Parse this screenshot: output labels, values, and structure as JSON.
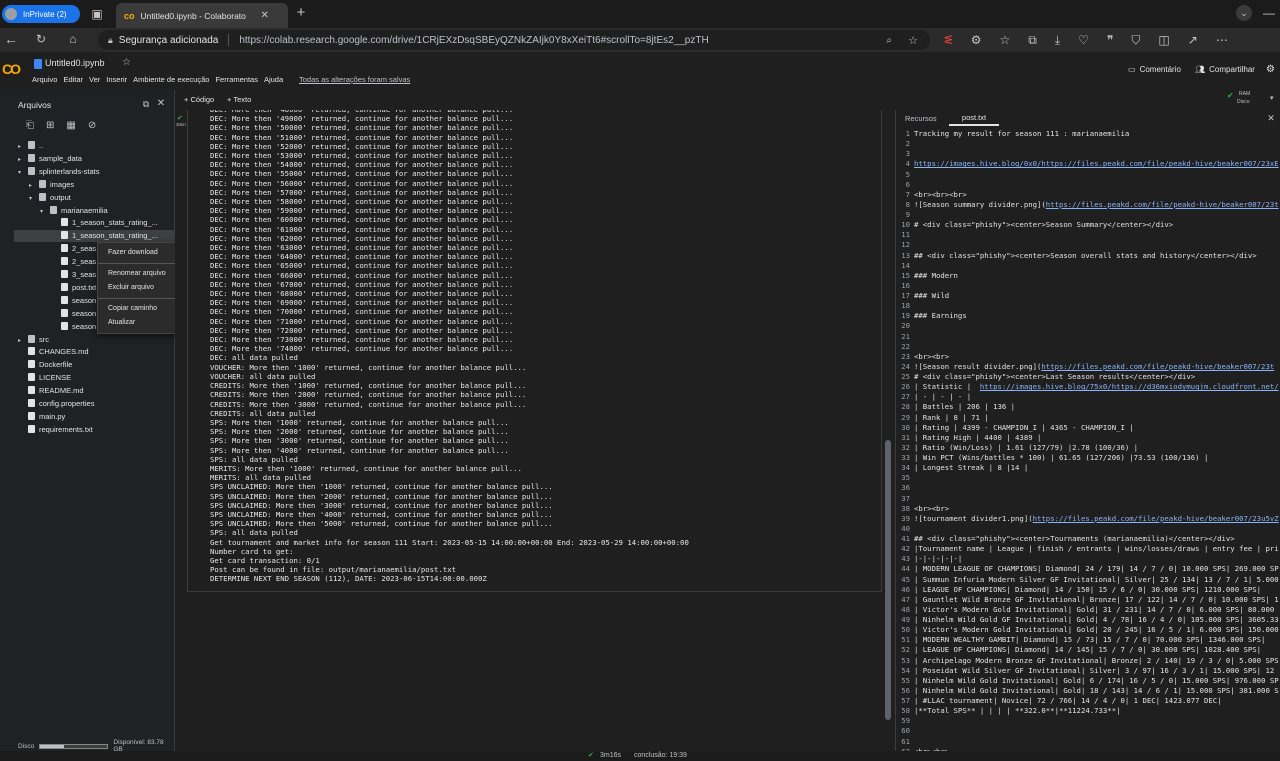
{
  "browser": {
    "profile": "InPrivate (2)",
    "tab_title": "Untitled0.ipynb - Colaborato",
    "security": "Segurança adicionada",
    "url": "https://colab.research.google.com/drive/1CRjEXzDsqSBEyQZNkZAIjk0Y8xXeiTt6#scrollTo=8jtEs2__pzTH"
  },
  "colab": {
    "notebook_name": "Untitled0.ipynb",
    "menu": [
      "Arquivo",
      "Editar",
      "Ver",
      "Inserir",
      "Ambiente de execução",
      "Ferramentas",
      "Ajuda"
    ],
    "saved_status": "Todas as alterações foram salvas",
    "comment": "Comentário",
    "share": "Compartilhar",
    "ram_label": "RAM",
    "disk_label": "Disco",
    "add_code": "+ Código",
    "add_text": "+ Texto"
  },
  "sidebar": {
    "title": "Arquivos",
    "disk_label": "Disco",
    "disk_available": "Disponível: 83.78 GB",
    "tree": [
      {
        "label": "..",
        "indent": 0,
        "kind": "folder"
      },
      {
        "label": "sample_data",
        "indent": 0,
        "kind": "folder"
      },
      {
        "label": "splinterlands-stats",
        "indent": 0,
        "kind": "folder-open"
      },
      {
        "label": "images",
        "indent": 1,
        "kind": "folder"
      },
      {
        "label": "output",
        "indent": 1,
        "kind": "folder-open"
      },
      {
        "label": "marianaemilia",
        "indent": 2,
        "kind": "folder-open"
      },
      {
        "label": "1_season_stats_rating_...",
        "indent": 3,
        "kind": "file"
      },
      {
        "label": "1_season_stats_rating_...",
        "indent": 3,
        "kind": "file"
      },
      {
        "label": "2_seas",
        "indent": 3,
        "kind": "file"
      },
      {
        "label": "2_seas",
        "indent": 3,
        "kind": "file"
      },
      {
        "label": "3_seas",
        "indent": 3,
        "kind": "file"
      },
      {
        "label": "post.txt",
        "indent": 3,
        "kind": "file"
      },
      {
        "label": "season",
        "indent": 3,
        "kind": "file"
      },
      {
        "label": "season",
        "indent": 3,
        "kind": "file"
      },
      {
        "label": "season",
        "indent": 3,
        "kind": "file"
      },
      {
        "label": "src",
        "indent": 0,
        "kind": "folder"
      },
      {
        "label": "CHANGES.md",
        "indent": 0,
        "kind": "file"
      },
      {
        "label": "Dockerfile",
        "indent": 0,
        "kind": "file"
      },
      {
        "label": "LICENSE",
        "indent": 0,
        "kind": "file"
      },
      {
        "label": "README.md",
        "indent": 0,
        "kind": "file"
      },
      {
        "label": "config.properties",
        "indent": 0,
        "kind": "file"
      },
      {
        "label": "main.py",
        "indent": 0,
        "kind": "file"
      },
      {
        "label": "requirements.txt",
        "indent": 0,
        "kind": "file"
      }
    ]
  },
  "context_menu": [
    "Fazer download",
    "Renomear arquivo",
    "Excluir arquivo",
    "Copiar caminho",
    "Atualizar"
  ],
  "cell": {
    "exec_time": "3min",
    "output": [
      "DEC: More then '48000' returned, continue for another balance pull...",
      "DEC: More then '49000' returned, continue for another balance pull...",
      "DEC: More then '50000' returned, continue for another balance pull...",
      "DEC: More then '51000' returned, continue for another balance pull...",
      "DEC: More then '52000' returned, continue for another balance pull...",
      "DEC: More then '53000' returned, continue for another balance pull...",
      "DEC: More then '54000' returned, continue for another balance pull...",
      "DEC: More then '55000' returned, continue for another balance pull...",
      "DEC: More then '56000' returned, continue for another balance pull...",
      "DEC: More then '57000' returned, continue for another balance pull...",
      "DEC: More then '58000' returned, continue for another balance pull...",
      "DEC: More then '59000' returned, continue for another balance pull...",
      "DEC: More then '60000' returned, continue for another balance pull...",
      "DEC: More then '61000' returned, continue for another balance pull...",
      "DEC: More then '62000' returned, continue for another balance pull...",
      "DEC: More then '63000' returned, continue for another balance pull...",
      "DEC: More then '64000' returned, continue for another balance pull...",
      "DEC: More then '65000' returned, continue for another balance pull...",
      "DEC: More then '66000' returned, continue for another balance pull...",
      "DEC: More then '67000' returned, continue for another balance pull...",
      "DEC: More then '68000' returned, continue for another balance pull...",
      "DEC: More then '69000' returned, continue for another balance pull...",
      "DEC: More then '70000' returned, continue for another balance pull...",
      "DEC: More then '71000' returned, continue for another balance pull...",
      "DEC: More then '72000' returned, continue for another balance pull...",
      "DEC: More then '73000' returned, continue for another balance pull...",
      "DEC: More then '74000' returned, continue for another balance pull...",
      "DEC: all data pulled",
      "VOUCHER: More then '1000' returned, continue for another balance pull...",
      "VOUCHER: all data pulled",
      "CREDITS: More then '1000' returned, continue for another balance pull...",
      "CREDITS: More then '2000' returned, continue for another balance pull...",
      "CREDITS: More then '3000' returned, continue for another balance pull...",
      "CREDITS: all data pulled",
      "SPS: More then '1000' returned, continue for another balance pull...",
      "SPS: More then '2000' returned, continue for another balance pull...",
      "SPS: More then '3000' returned, continue for another balance pull...",
      "SPS: More then '4000' returned, continue for another balance pull...",
      "SPS: all data pulled",
      "MERITS: More then '1000' returned, continue for another balance pull...",
      "MERITS: all data pulled",
      "SPS UNCLAIMED: More then '1000' returned, continue for another balance pull...",
      "SPS UNCLAIMED: More then '2000' returned, continue for another balance pull...",
      "SPS UNCLAIMED: More then '3000' returned, continue for another balance pull...",
      "SPS UNCLAIMED: More then '4000' returned, continue for another balance pull...",
      "SPS UNCLAIMED: More then '5000' returned, continue for another balance pull...",
      "SPS: all data pulled",
      "Get tournament and market info for season 111 Start: 2023-05-15 14:00:00+00:00 End: 2023-05-29 14:00:00+00:00",
      "Number card to get:",
      "Get card transaction: 0/1",
      "Post can be found in file: output/marianaemilia/post.txt",
      "DETERMINE NEXT END SEASON (112), DATE: 2023-06-15T14:00:00.000Z"
    ]
  },
  "right": {
    "tab_resources": "Recursos",
    "tab_file": "post.txt",
    "lines": [
      "Tracking my result for season 111 : marianaemilia",
      "",
      "",
      "https://images.hive.blog/0x0/https://files.peakd.com/file/peakd-hive/beaker007/23xE",
      "",
      "",
      "<br><br><br>",
      "![Season summary divider.png](https://files.peakd.com/file/peakd-hive/beaker007/23t",
      "",
      "# <div class=\"phishy\"><center>Season Summary</center></div>",
      "",
      "",
      "## <div class=\"phishy\"><center>Season overall stats and history</center></div>",
      "",
      "### Modern",
      "",
      "### Wild",
      "",
      "### Earnings",
      "",
      "",
      "",
      "<br><br>",
      "![Season result divider.png](https://files.peakd.com/file/peakd-hive/beaker007/23t",
      "# <div class=\"phishy\"><center>Last Season results</center></div>",
      "| Statistic |  https://images.hive.blog/75x0/https://d36mxiodymuqjm.cloudfront.net/",
      "| - | - | - |",
      "| Battles | 206 | 136 |",
      "| Rank | 8 | 71 |",
      "| Rating | 4399 - CHAMPION_I | 4365 - CHAMPION_I |",
      "| Rating High | 4400 | 4389 |",
      "| Ratio (Win/Loss) | 1.61 (127/79) |2.78 (100/36) |",
      "| Win PCT (Wins/battles * 100) | 61.65 (127/206) |73.53 (100/136) |",
      "| Longest Streak | 8 |14 |",
      "",
      "",
      "",
      "<br><br>",
      "![tournament divider1.png](https://files.peakd.com/file/peakd-hive/beaker007/23u5vZ",
      "",
      "## <div class=\"phishy\"><center>Tournaments (marianaemilia)</center></div>",
      "|Tournament name | League | finish / entrants | wins/losses/draws | entry fee | pri",
      "|-|-|-|-|-|",
      "| MODERN LEAGUE OF CHAMPIONS| Diamond| 24 / 179| 14 / 7 / 0| 10.000 SPS| 269.000 SP",
      "| Summun Infuria Modern Silver GF Invitational| Silver| 25 / 134| 13 / 7 / 1| 5.000",
      "| LEAGUE OF CHAMPIONS| Diamond| 14 / 150| 15 / 6 / 0| 30.000 SPS| 1210.000 SPS|",
      "| Gauntlet Wild Bronze GF Invitational| Bronze| 17 / 122| 14 / 7 / 0| 10.000 SPS| 1",
      "| Victor's Modern Gold Invitational| Gold| 31 / 231| 14 / 7 / 0| 6.000 SPS| 80.000",
      "| Ninhelm Wild Gold GF Invitational| Gold| 4 / 78| 16 / 4 / 0| 105.000 SPS| 3605.33",
      "| Victor's Modern Gold Invitational| Gold| 20 / 245| 16 / 5 / 1| 6.000 SPS| 150.000",
      "| MODERN WEALTHY GAMBIT| Diamond| 15 / 73| 15 / 7 / 0| 70.000 SPS| 1346.000 SPS|",
      "| LEAGUE OF CHAMPIONS| Diamond| 14 / 145| 15 / 7 / 0| 30.000 SPS| 1028.400 SPS|",
      "| Archipelago Modern Bronze GF Invitational| Bronze| 2 / 140| 19 / 3 / 0| 5.000 SPS",
      "| Poseidat Wild Silver GF Invitational| Silver| 3 / 97| 16 / 3 / 1| 15.000 SPS| 12",
      "| Ninhelm Wild Gold Invitational| Gold| 6 / 174| 16 / 5 / 0| 15.000 SPS| 976.000 SP",
      "| Ninhelm Wild Gold Invitational| Gold| 18 / 143| 14 / 6 / 1| 15.000 SPS| 381.000 S",
      "| #LLAC tournament| Novice| 72 / 766| 14 / 4 / 0| 1 DEC| 1423.077 DEC|",
      "|**Total SPS** | | | | **322.0**|**11224.733**|",
      "",
      "",
      "",
      "<br><br>"
    ]
  },
  "status": {
    "elapsed": "3m16s",
    "completion": "conclusão: 19:39"
  }
}
